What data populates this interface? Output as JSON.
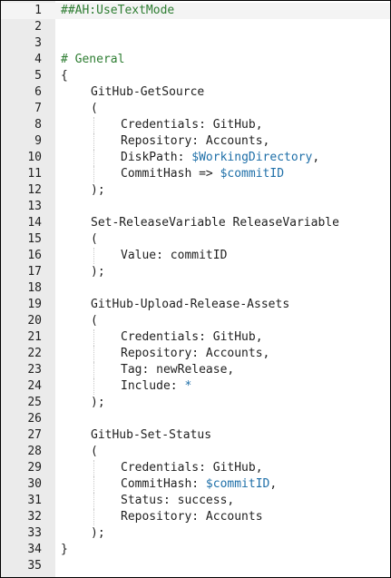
{
  "editor": {
    "lines": [
      {
        "no": "1",
        "indent": 0,
        "parts": [
          {
            "t": "##AH:UseTextMode",
            "k": "directive"
          }
        ]
      },
      {
        "no": "2",
        "indent": 0,
        "parts": []
      },
      {
        "no": "3",
        "indent": 0,
        "parts": []
      },
      {
        "no": "4",
        "indent": 0,
        "parts": [
          {
            "t": "# General",
            "k": "comment"
          }
        ]
      },
      {
        "no": "5",
        "indent": 0,
        "parts": [
          {
            "t": "{",
            "k": "text"
          }
        ]
      },
      {
        "no": "6",
        "indent": 1,
        "parts": [
          {
            "t": "GitHub-GetSource",
            "k": "text"
          }
        ]
      },
      {
        "no": "7",
        "indent": 1,
        "parts": [
          {
            "t": "(",
            "k": "text"
          }
        ]
      },
      {
        "no": "8",
        "indent": 2,
        "parts": [
          {
            "t": "Credentials: GitHub,",
            "k": "text"
          }
        ]
      },
      {
        "no": "9",
        "indent": 2,
        "parts": [
          {
            "t": "Repository: Accounts,",
            "k": "text"
          }
        ]
      },
      {
        "no": "10",
        "indent": 2,
        "parts": [
          {
            "t": "DiskPath: ",
            "k": "text"
          },
          {
            "t": "$WorkingDirectory",
            "k": "var"
          },
          {
            "t": ",",
            "k": "text"
          }
        ]
      },
      {
        "no": "11",
        "indent": 2,
        "parts": [
          {
            "t": "CommitHash => ",
            "k": "text"
          },
          {
            "t": "$commitID",
            "k": "var"
          }
        ]
      },
      {
        "no": "12",
        "indent": 1,
        "parts": [
          {
            "t": ");",
            "k": "text"
          }
        ]
      },
      {
        "no": "13",
        "indent": 0,
        "parts": []
      },
      {
        "no": "14",
        "indent": 1,
        "parts": [
          {
            "t": "Set-ReleaseVariable ReleaseVariable",
            "k": "text"
          }
        ]
      },
      {
        "no": "15",
        "indent": 1,
        "parts": [
          {
            "t": "(",
            "k": "text"
          }
        ]
      },
      {
        "no": "16",
        "indent": 2,
        "parts": [
          {
            "t": "Value: commitID",
            "k": "text"
          }
        ]
      },
      {
        "no": "17",
        "indent": 1,
        "parts": [
          {
            "t": ");",
            "k": "text"
          }
        ]
      },
      {
        "no": "18",
        "indent": 0,
        "parts": []
      },
      {
        "no": "19",
        "indent": 1,
        "parts": [
          {
            "t": "GitHub-Upload-Release-Assets",
            "k": "text"
          }
        ]
      },
      {
        "no": "20",
        "indent": 1,
        "parts": [
          {
            "t": "(",
            "k": "text"
          }
        ]
      },
      {
        "no": "21",
        "indent": 2,
        "parts": [
          {
            "t": "Credentials: GitHub,",
            "k": "text"
          }
        ]
      },
      {
        "no": "22",
        "indent": 2,
        "parts": [
          {
            "t": "Repository: Accounts,",
            "k": "text"
          }
        ]
      },
      {
        "no": "23",
        "indent": 2,
        "parts": [
          {
            "t": "Tag: newRelease,",
            "k": "text"
          }
        ]
      },
      {
        "no": "24",
        "indent": 2,
        "parts": [
          {
            "t": "Include: ",
            "k": "text"
          },
          {
            "t": "*",
            "k": "var"
          }
        ]
      },
      {
        "no": "25",
        "indent": 1,
        "parts": [
          {
            "t": ");",
            "k": "text"
          }
        ]
      },
      {
        "no": "26",
        "indent": 0,
        "parts": []
      },
      {
        "no": "27",
        "indent": 1,
        "parts": [
          {
            "t": "GitHub-Set-Status",
            "k": "text"
          }
        ]
      },
      {
        "no": "28",
        "indent": 1,
        "parts": [
          {
            "t": "(",
            "k": "text"
          }
        ]
      },
      {
        "no": "29",
        "indent": 2,
        "parts": [
          {
            "t": "Credentials: GitHub,",
            "k": "text"
          }
        ]
      },
      {
        "no": "30",
        "indent": 2,
        "parts": [
          {
            "t": "CommitHash: ",
            "k": "text"
          },
          {
            "t": "$commitID",
            "k": "var"
          },
          {
            "t": ",",
            "k": "text"
          }
        ]
      },
      {
        "no": "31",
        "indent": 2,
        "parts": [
          {
            "t": "Status: success,",
            "k": "text"
          }
        ]
      },
      {
        "no": "32",
        "indent": 2,
        "parts": [
          {
            "t": "Repository: Accounts",
            "k": "text"
          }
        ]
      },
      {
        "no": "33",
        "indent": 1,
        "parts": [
          {
            "t": ");",
            "k": "text"
          }
        ]
      },
      {
        "no": "34",
        "indent": 0,
        "parts": [
          {
            "t": "}",
            "k": "text"
          }
        ]
      },
      {
        "no": "35",
        "indent": 0,
        "parts": []
      }
    ],
    "current_line": "1"
  },
  "colors": {
    "gutter": "#ebebeb",
    "comment": "#2e7d32",
    "variable": "#1e6fa8",
    "text": "#1f1f1f"
  }
}
